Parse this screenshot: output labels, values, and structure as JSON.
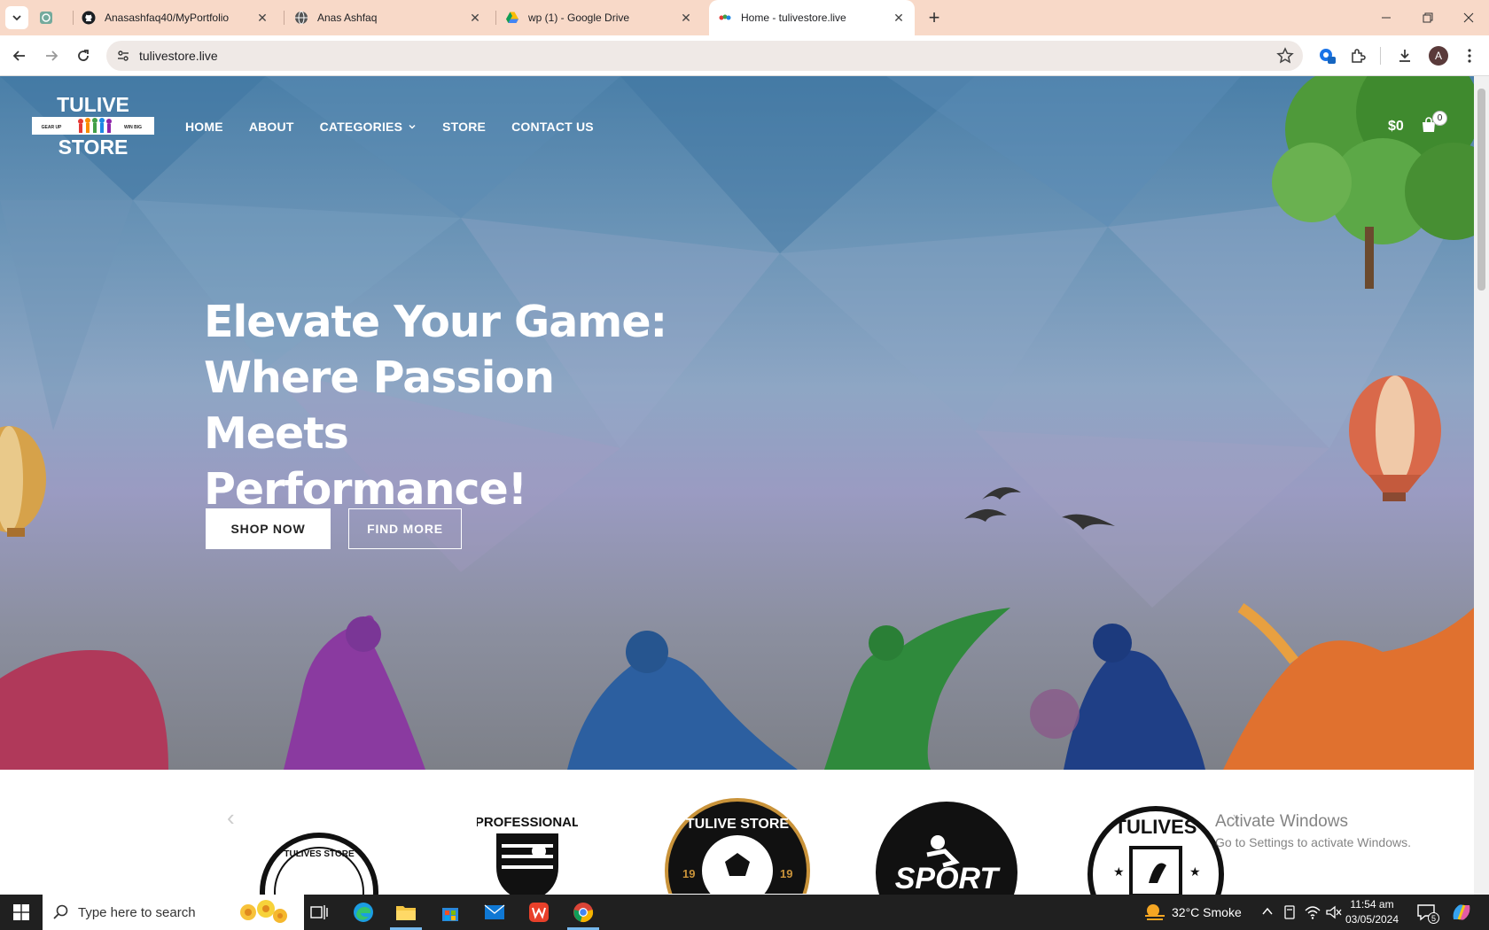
{
  "browser": {
    "tabs": [
      {
        "title": "",
        "icon": "chatgpt-icon",
        "active": false
      },
      {
        "title": "Anasashfaq40/MyPortfolio",
        "icon": "github-icon",
        "active": false
      },
      {
        "title": "Anas Ashfaq",
        "icon": "globe-icon",
        "active": false
      },
      {
        "title": "wp (1) - Google Drive",
        "icon": "google-drive-icon",
        "active": false
      },
      {
        "title": "Home - tulivestore.live",
        "icon": "site-favicon",
        "active": true
      }
    ],
    "url": "tulivestore.live",
    "profile_initial": "A"
  },
  "site": {
    "logo": {
      "top": "TULIVE",
      "bottom": "STORE",
      "left_tag": "GEAR UP",
      "right_tag": "WIN BIG"
    },
    "nav": [
      {
        "label": "HOME"
      },
      {
        "label": "ABOUT"
      },
      {
        "label": "CATEGORIES",
        "has_dropdown": true
      },
      {
        "label": "STORE"
      },
      {
        "label": "CONTACT US"
      }
    ],
    "cart_total": "$0",
    "cart_count": "0",
    "hero": {
      "title_line1": "Elevate Your Game:",
      "title_line2": "Where Passion Meets",
      "title_line3": "Performance!",
      "primary_button": "SHOP NOW",
      "secondary_button": "FIND MORE"
    },
    "brands": [
      {
        "name": "TULIVES STORE"
      },
      {
        "name": "PROFESSIONAL"
      },
      {
        "name": "TULIVE STORE",
        "year_left": "19",
        "year_right": "19"
      },
      {
        "name": "SPORT"
      },
      {
        "name": "TULIVES"
      }
    ]
  },
  "watermark": {
    "line1": "Activate Windows",
    "line2": "Go to Settings to activate Windows."
  },
  "taskbar": {
    "search_placeholder": "Type here to search",
    "weather": "32°C  Smoke",
    "time": "11:54 am",
    "date": "03/05/2024",
    "notification_count": "5"
  }
}
